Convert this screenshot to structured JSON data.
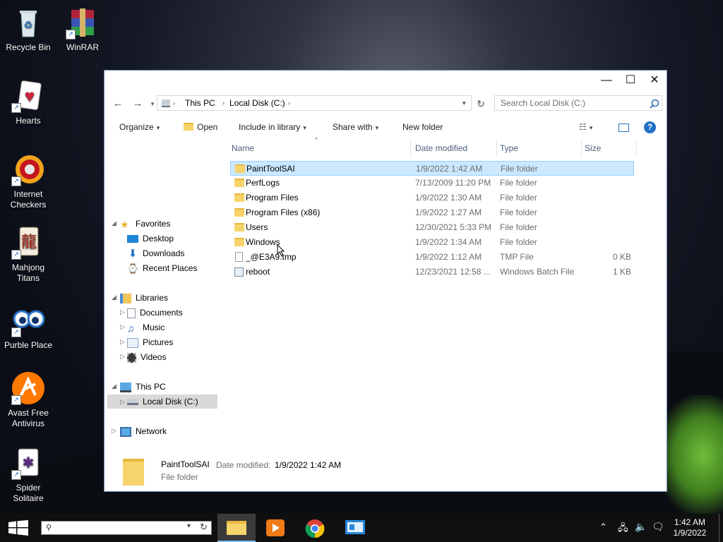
{
  "desktop": {
    "icons": [
      {
        "label": "Recycle Bin"
      },
      {
        "label": "WinRAR"
      },
      {
        "label": "Hearts"
      },
      {
        "label": "Internet Checkers"
      },
      {
        "label": "Mahjong Titans"
      },
      {
        "label": "Purble Place"
      },
      {
        "label": "Avast Free Antivirus"
      },
      {
        "label": "Spider Solitaire"
      }
    ]
  },
  "window": {
    "controls": {
      "minimize": "—",
      "maximize": "☐",
      "close": "✕"
    },
    "address": {
      "breadcrumb": [
        "This PC",
        "Local Disk (C:)"
      ],
      "separator": "›"
    },
    "search": {
      "placeholder": "Search Local Disk (C:)"
    },
    "toolbar": {
      "organize": "Organize",
      "open": "Open",
      "include_in_library": "Include in library",
      "share_with": "Share with",
      "new_folder": "New folder"
    },
    "nav": {
      "favorites": "Favorites",
      "desktop": "Desktop",
      "downloads": "Downloads",
      "recent_places": "Recent Places",
      "libraries": "Libraries",
      "documents": "Documents",
      "music": "Music",
      "pictures": "Pictures",
      "videos": "Videos",
      "this_pc": "This PC",
      "local_disk": "Local Disk (C:)",
      "network": "Network"
    },
    "columns": {
      "name": "Name",
      "date": "Date modified",
      "type": "Type",
      "size": "Size"
    },
    "files": [
      {
        "name": "PaintToolSAI",
        "date": "1/9/2022 1:42 AM",
        "type": "File folder",
        "size": ""
      },
      {
        "name": "PerfLogs",
        "date": "7/13/2009 11:20 PM",
        "type": "File folder",
        "size": ""
      },
      {
        "name": "Program Files",
        "date": "1/9/2022 1:30 AM",
        "type": "File folder",
        "size": ""
      },
      {
        "name": "Program Files (x86)",
        "date": "1/9/2022 1:27 AM",
        "type": "File folder",
        "size": ""
      },
      {
        "name": "Users",
        "date": "12/30/2021 5:33 PM",
        "type": "File folder",
        "size": ""
      },
      {
        "name": "Windows",
        "date": "1/9/2022 1:34 AM",
        "type": "File folder",
        "size": ""
      },
      {
        "name": "_@E3A9.tmp",
        "date": "1/9/2022 1:12 AM",
        "type": "TMP File",
        "size": "0 KB"
      },
      {
        "name": "reboot",
        "date": "12/23/2021 12:58 ...",
        "type": "Windows Batch File",
        "size": "1 KB"
      }
    ],
    "details": {
      "name": "PaintToolSAI",
      "date_label": "Date modified:",
      "date_value": "1/9/2022 1:42 AM",
      "type": "File folder"
    }
  },
  "taskbar": {
    "time": "1:42 AM",
    "date": "1/9/2022"
  },
  "colors": {
    "accent": "#0078d7",
    "selection": "#cce8ff",
    "folder": "#f7d36b"
  }
}
